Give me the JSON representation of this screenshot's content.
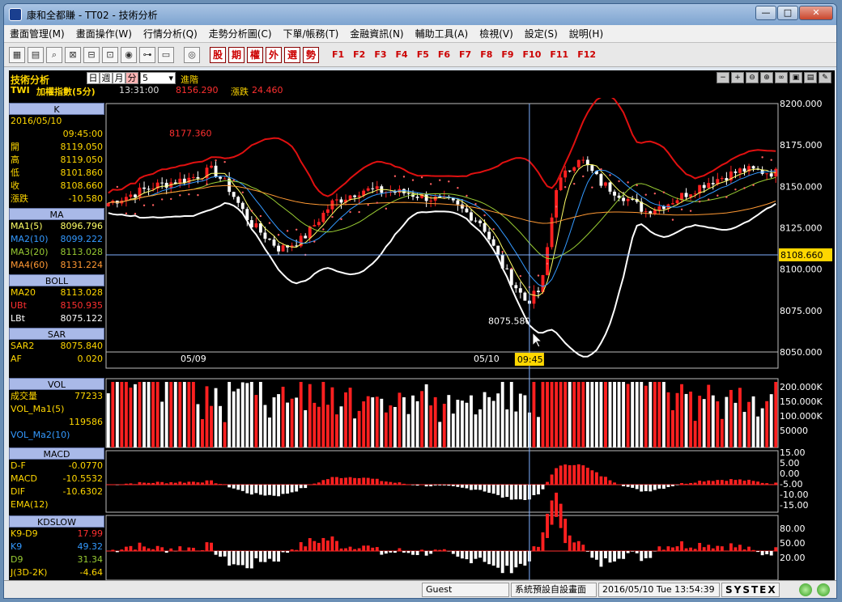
{
  "window": {
    "title": "康和全都賺 - TT02 - 技術分析",
    "min": "—",
    "max": "□",
    "close": "✕"
  },
  "menu": [
    "畫面管理(M)",
    "畫面操作(W)",
    "行情分析(Q)",
    "走勢分析圖(C)",
    "下單/帳務(T)",
    "金融資訊(N)",
    "輔助工具(A)",
    "檢視(V)",
    "設定(S)",
    "說明(H)"
  ],
  "toolbar": {
    "red_buttons": [
      "股",
      "期",
      "權",
      "外",
      "選",
      "勢"
    ],
    "fkeys": [
      "F1",
      "F2",
      "F3",
      "F4",
      "F5",
      "F6",
      "F7",
      "F8",
      "F9",
      "F10",
      "F11",
      "F12"
    ]
  },
  "header": {
    "module": "技術分析",
    "period_tabs": [
      "日",
      "週",
      "月",
      "分"
    ],
    "interval": "5",
    "advanced": "進階",
    "symbol": "TWI",
    "name": "加權指數(5分)",
    "time": "13:31:00",
    "price": "8156.290",
    "change_label": "漲跌",
    "change": "24.460"
  },
  "panels": {
    "k": {
      "title": "K",
      "date": "2016/05/10",
      "time": "09:45:00",
      "rows": [
        {
          "label": "開",
          "value": "8119.050"
        },
        {
          "label": "高",
          "value": "8119.050"
        },
        {
          "label": "低",
          "value": "8101.860"
        },
        {
          "label": "收",
          "value": "8108.660"
        },
        {
          "label": "漲跌",
          "value": "-10.580"
        }
      ]
    },
    "ma": {
      "title": "MA",
      "rows": [
        {
          "label": "MA1(5)",
          "value": "8096.796"
        },
        {
          "label": "MA2(10)",
          "value": "8099.222"
        },
        {
          "label": "MA3(20)",
          "value": "8113.028"
        },
        {
          "label": "MA4(60)",
          "value": "8131.224"
        }
      ]
    },
    "boll": {
      "title": "BOLL",
      "rows": [
        {
          "label": "MA20",
          "value": "8113.028"
        },
        {
          "label": "UBt",
          "value": "8150.935"
        },
        {
          "label": "LBt",
          "value": "8075.122"
        }
      ]
    },
    "sar": {
      "title": "SAR",
      "rows": [
        {
          "label": "SAR2",
          "value": "8075.840"
        },
        {
          "label": "AF",
          "value": "0.020"
        }
      ]
    },
    "vol": {
      "title": "VOL",
      "rows": [
        {
          "label": "成交量",
          "value": "77233"
        },
        {
          "label": "VOL_Ma1(5)",
          "value": ""
        },
        {
          "label": "",
          "value": "119586"
        },
        {
          "label": "VOL_Ma2(10)",
          "value": ""
        }
      ]
    },
    "macd": {
      "title": "MACD",
      "rows": [
        {
          "label": "D-F",
          "value": "-0.0770"
        },
        {
          "label": "MACD",
          "value": "-10.5532"
        },
        {
          "label": "DIF",
          "value": "-10.6302"
        },
        {
          "label": "EMA(12)",
          "value": ""
        }
      ]
    },
    "kd": {
      "title": "KDSLOW",
      "rows": [
        {
          "label": "K9-D9",
          "value": "17.99"
        },
        {
          "label": "K9",
          "value": "49.32"
        },
        {
          "label": "D9",
          "value": "31.34"
        },
        {
          "label": "J(3D-2K)",
          "value": "-4.64"
        }
      ]
    }
  },
  "price_axis": [
    "8200.000",
    "8175.000",
    "8150.000",
    "8125.000",
    "8100.000",
    "8075.000",
    "8050.000"
  ],
  "vol_axis": [
    "200.000K",
    "150.000K",
    "100.000K",
    "50000"
  ],
  "macd_axis": [
    "15.00",
    "5.00",
    "0.00",
    "-5.00",
    "-10.00",
    "-15.00"
  ],
  "kd_axis": [
    "80.00",
    "50.00",
    "20.00"
  ],
  "date_labels": [
    "05/09",
    "05/10"
  ],
  "cursor": {
    "time": "09:45",
    "price": "8108.660"
  },
  "annotations": {
    "high": "8177.360",
    "low": "8075.580"
  },
  "colors": {
    "up": "#ff2020",
    "down": "#ffffff",
    "boll_up": "#e01010",
    "boll_low": "#ffffff",
    "sar": "#ff6060",
    "ma5": "#ffff66",
    "ma10": "#3399ff",
    "ma20": "#99cc33",
    "ma60": "#ff9933"
  },
  "status": {
    "user": "Guest",
    "screen": "系統預設自設畫面",
    "datetime": "2016/05/10 Tue 13:54:39",
    "brand": "SYSTEX"
  }
}
